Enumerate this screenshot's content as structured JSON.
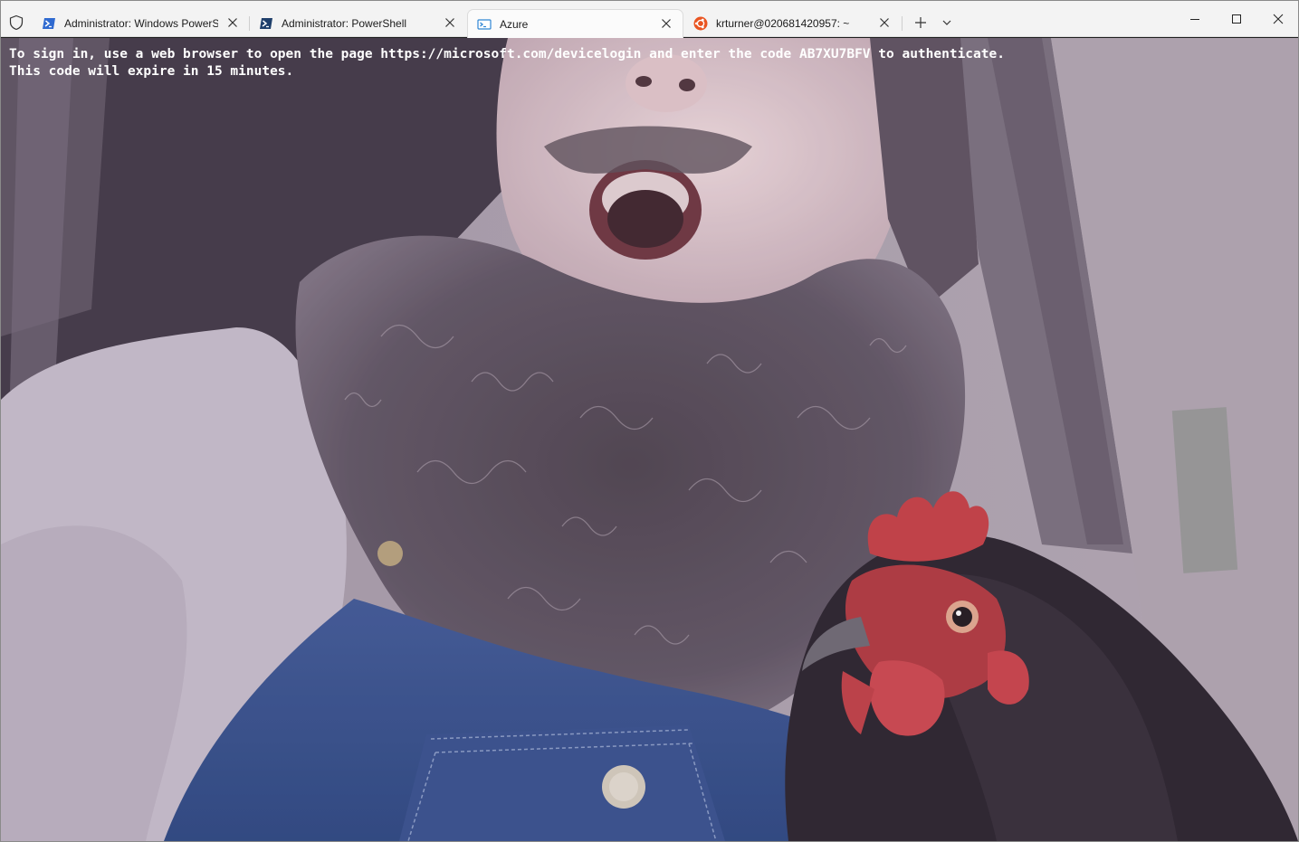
{
  "tabs": [
    {
      "title": "Administrator: Windows PowerShell",
      "icon": "powershell-icon",
      "active": false
    },
    {
      "title": "Administrator: PowerShell",
      "icon": "powershell-core-icon",
      "active": false
    },
    {
      "title": "Azure",
      "icon": "azure-cloud-shell-icon",
      "active": true
    },
    {
      "title": "krturner@020681420957: ~",
      "icon": "ubuntu-icon",
      "active": false
    }
  ],
  "titlebar": {
    "new_tab_icon": "plus-icon",
    "dropdown_icon": "chevron-down-icon",
    "minimize_icon": "minimize-icon",
    "maximize_icon": "maximize-icon",
    "close_icon": "close-icon"
  },
  "terminal": {
    "lines": [
      "To sign in, use a web browser to open the page https://microsoft.com/devicelogin and enter the code AB7XU7BFV to authenticate.",
      "This code will expire in 15 minutes."
    ],
    "background": "photo-background-bearded-man-with-chicken"
  },
  "colors": {
    "titlebar_bg": "#f3f3f3",
    "active_tab_bg": "#fbfbfb",
    "terminal_text": "#ffffff",
    "terminal_tint": "#8f8594"
  }
}
